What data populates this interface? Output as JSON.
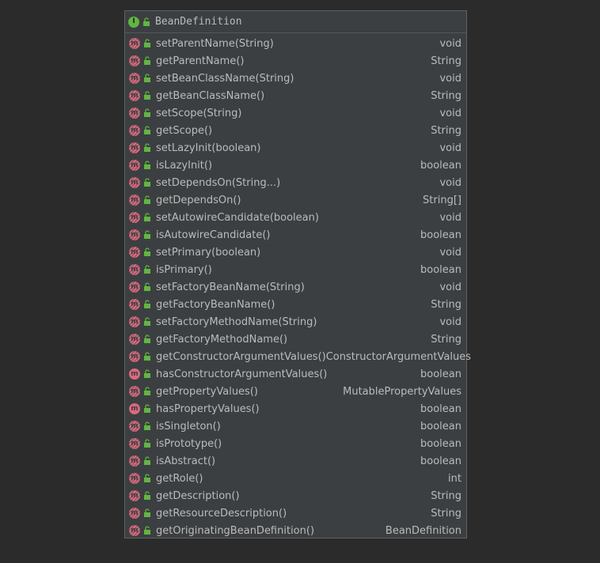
{
  "class": {
    "name": "BeanDefinition",
    "kind_badge": "I",
    "kind_icon": "interface-icon"
  },
  "colors": {
    "interface_badge": "#62b543",
    "method_badge": "#d96a7e",
    "public_lock": "#62b543",
    "text": "#bbbbbb",
    "background": "#2b2b2b",
    "panel": "#3c3f41"
  },
  "methods": [
    {
      "name": "setParentName(String)",
      "type": "void",
      "abstract": true
    },
    {
      "name": "getParentName()",
      "type": "String",
      "abstract": true
    },
    {
      "name": "setBeanClassName(String)",
      "type": "void",
      "abstract": true
    },
    {
      "name": "getBeanClassName()",
      "type": "String",
      "abstract": true
    },
    {
      "name": "setScope(String)",
      "type": "void",
      "abstract": true
    },
    {
      "name": "getScope()",
      "type": "String",
      "abstract": true
    },
    {
      "name": "setLazyInit(boolean)",
      "type": "void",
      "abstract": true
    },
    {
      "name": "isLazyInit()",
      "type": "boolean",
      "abstract": true
    },
    {
      "name": "setDependsOn(String...)",
      "type": "void",
      "abstract": true
    },
    {
      "name": "getDependsOn()",
      "type": "String[]",
      "abstract": true
    },
    {
      "name": "setAutowireCandidate(boolean)",
      "type": "void",
      "abstract": true
    },
    {
      "name": "isAutowireCandidate()",
      "type": "boolean",
      "abstract": true
    },
    {
      "name": "setPrimary(boolean)",
      "type": "void",
      "abstract": true
    },
    {
      "name": "isPrimary()",
      "type": "boolean",
      "abstract": true
    },
    {
      "name": "setFactoryBeanName(String)",
      "type": "void",
      "abstract": true
    },
    {
      "name": "getFactoryBeanName()",
      "type": "String",
      "abstract": true
    },
    {
      "name": "setFactoryMethodName(String)",
      "type": "void",
      "abstract": true
    },
    {
      "name": "getFactoryMethodName()",
      "type": "String",
      "abstract": true
    },
    {
      "name": "getConstructorArgumentValues()",
      "type": "ConstructorArgumentValues",
      "abstract": true
    },
    {
      "name": "hasConstructorArgumentValues()",
      "type": "boolean",
      "abstract": false
    },
    {
      "name": "getPropertyValues()",
      "type": "MutablePropertyValues",
      "abstract": true
    },
    {
      "name": "hasPropertyValues()",
      "type": "boolean",
      "abstract": false
    },
    {
      "name": "isSingleton()",
      "type": "boolean",
      "abstract": true
    },
    {
      "name": "isPrototype()",
      "type": "boolean",
      "abstract": true
    },
    {
      "name": "isAbstract()",
      "type": "boolean",
      "abstract": true
    },
    {
      "name": "getRole()",
      "type": "int",
      "abstract": true
    },
    {
      "name": "getDescription()",
      "type": "String",
      "abstract": true
    },
    {
      "name": "getResourceDescription()",
      "type": "String",
      "abstract": true
    },
    {
      "name": "getOriginatingBeanDefinition()",
      "type": "BeanDefinition",
      "abstract": true
    }
  ],
  "icons": {
    "method_badge_letter": "m",
    "method_icon": "method-icon",
    "visibility_icon": "public-lock-icon"
  }
}
